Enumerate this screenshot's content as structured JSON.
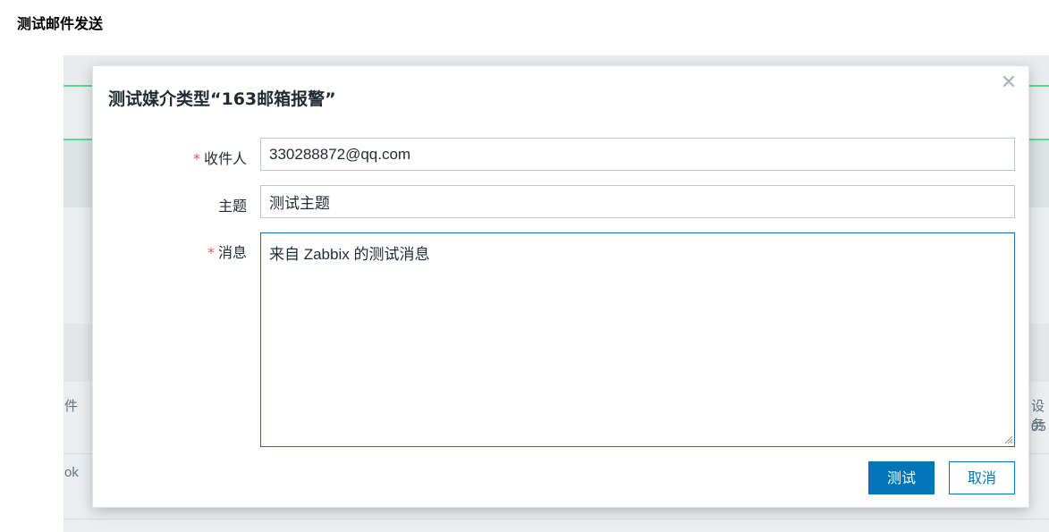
{
  "page": {
    "heading": "测试邮件发送"
  },
  "background": {
    "left_fragments": [
      "件",
      "ok"
    ],
    "right_fragments": [
      "设务",
      "05"
    ]
  },
  "dialog": {
    "title": "测试媒介类型“163邮箱报警”",
    "close_icon": "close-icon",
    "fields": {
      "recipient": {
        "label": "收件人",
        "required": true,
        "value": "330288872@qq.com"
      },
      "subject": {
        "label": "主题",
        "required": false,
        "value": "测试主题"
      },
      "message": {
        "label": "消息",
        "required": true,
        "value": "来自 Zabbix 的测试消息"
      }
    },
    "required_marker": "*",
    "buttons": {
      "test": "测试",
      "cancel": "取消"
    }
  },
  "colors": {
    "primary": "#0275b8",
    "required": "#e45959",
    "accent_green": "#59db8f"
  }
}
